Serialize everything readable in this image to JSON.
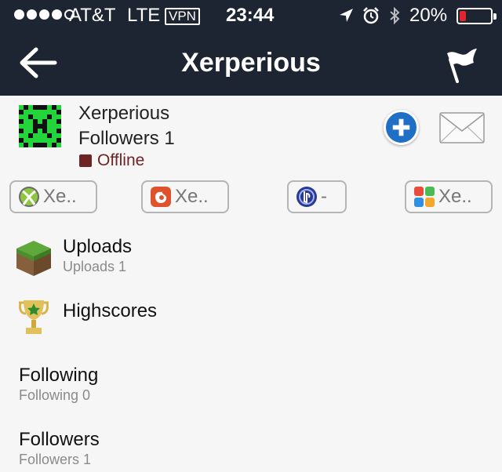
{
  "status_bar": {
    "carrier": "AT&T",
    "network": "LTE",
    "vpn": "VPN",
    "time": "23:44",
    "battery_percent": "20%",
    "battery_level": 0.2,
    "signal_bars_filled": 4,
    "signal_bars_total": 5
  },
  "nav": {
    "title": "Xerperious",
    "back_icon": "back-arrow-icon",
    "flag_icon": "flag-icon"
  },
  "profile": {
    "name": "Xerperious",
    "followers": "Followers 1",
    "status": "Offline",
    "status_color": "#6e2424"
  },
  "platforms": [
    {
      "icon": "xbox-icon",
      "label": "Xe.."
    },
    {
      "icon": "origin-icon",
      "label": "Xe.."
    },
    {
      "icon": "playstation-network-icon",
      "label": "-"
    },
    {
      "icon": "game-center-icon",
      "label": "Xe.."
    }
  ],
  "list": {
    "uploads": {
      "title": "Uploads",
      "subtitle": "Uploads 1",
      "icon": "grass-block-icon"
    },
    "highscores": {
      "title": "Highscores",
      "icon": "trophy-icon"
    },
    "following": {
      "title": "Following",
      "subtitle": "Following 0"
    },
    "followers": {
      "title": "Followers",
      "subtitle": "Followers 1"
    }
  },
  "colors": {
    "nav_bg": "#1d2432",
    "accent_blue": "#1f6fc6",
    "battery_low": "#e0262c"
  }
}
